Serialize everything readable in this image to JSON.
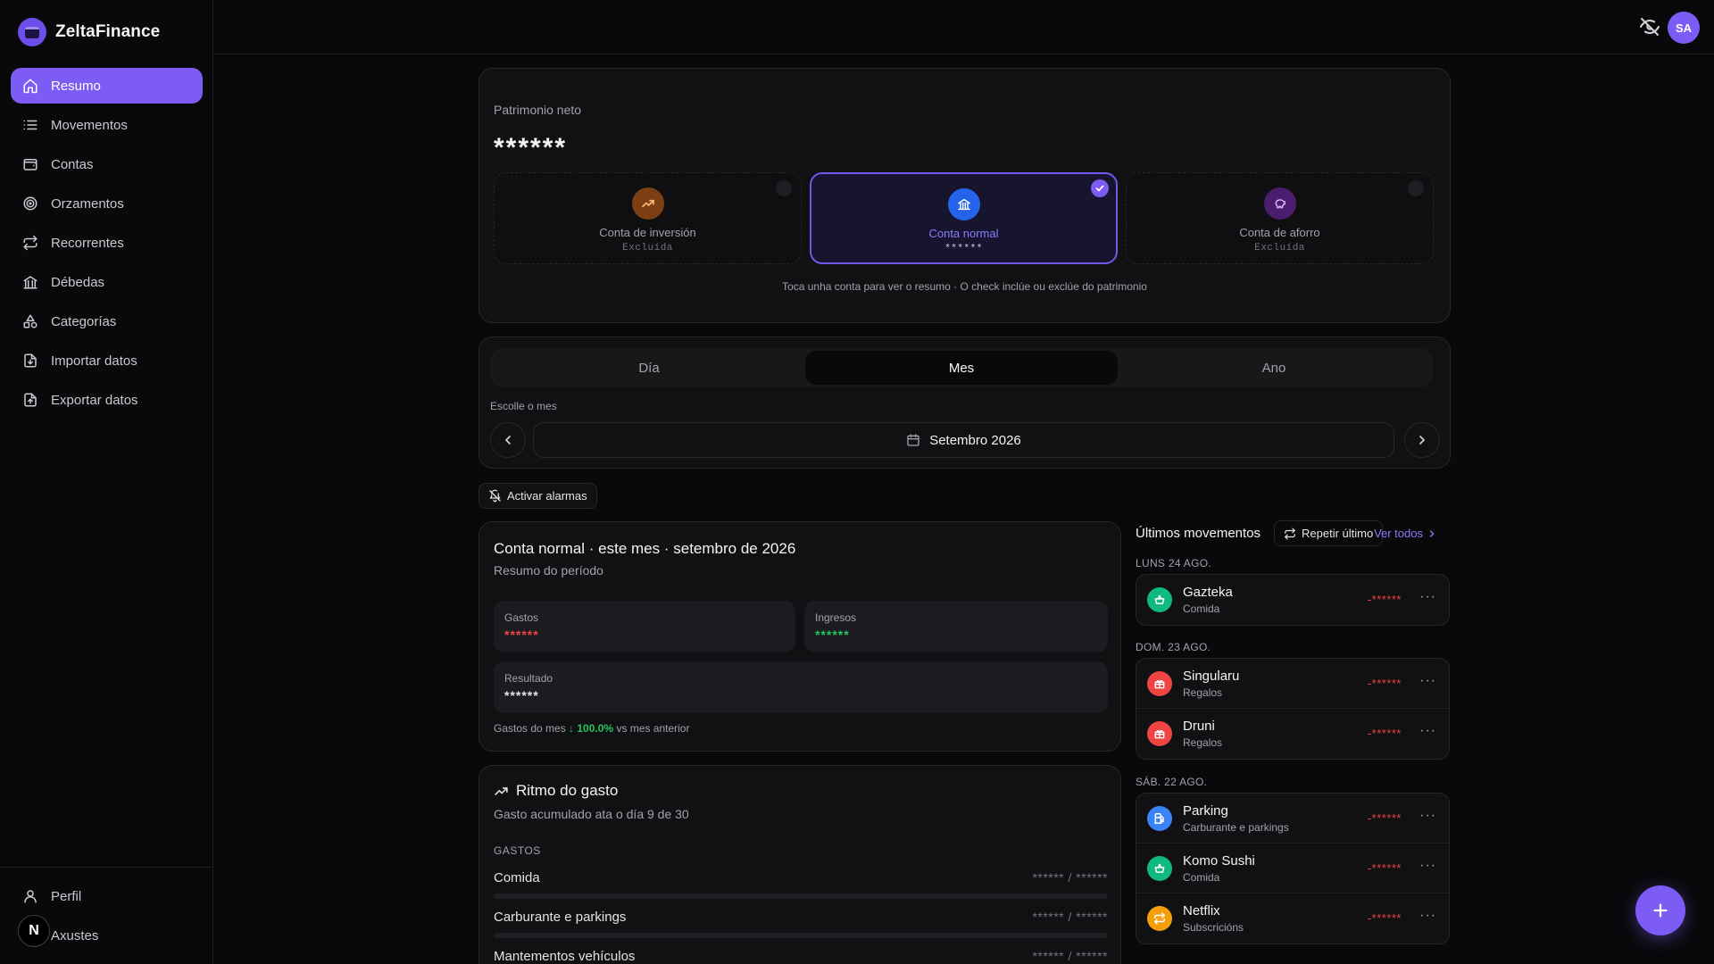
{
  "app": {
    "name": "ZeltaFinance",
    "user_initials": "SA"
  },
  "nav": {
    "items": [
      {
        "label": "Resumo",
        "icon": "home-icon",
        "active": true
      },
      {
        "label": "Movementos",
        "icon": "list-icon"
      },
      {
        "label": "Contas",
        "icon": "wallet-icon"
      },
      {
        "label": "Orzamentos",
        "icon": "target-icon"
      },
      {
        "label": "Recorrentes",
        "icon": "repeat-icon"
      },
      {
        "label": "Débedas",
        "icon": "bank-icon"
      },
      {
        "label": "Categorías",
        "icon": "shapes-icon"
      },
      {
        "label": "Importar datos",
        "icon": "file-import-icon"
      },
      {
        "label": "Exportar datos",
        "icon": "file-export-icon"
      }
    ],
    "bottom": [
      {
        "label": "Perfil",
        "icon": "user-icon"
      },
      {
        "label": "Axustes",
        "icon": "settings-icon"
      }
    ],
    "badge": "N"
  },
  "net_worth": {
    "label": "Patrimonio neto",
    "value": "******",
    "accounts": [
      {
        "name": "Conta de inversión",
        "sub": "Excluída",
        "icon": "trending-up-icon",
        "color": "#b45309",
        "selected": false
      },
      {
        "name": "Conta normal",
        "sub": "******",
        "icon": "bank-icon",
        "color": "#2563eb",
        "selected": true
      },
      {
        "name": "Conta de aforro",
        "sub": "Excluída",
        "icon": "piggy-bank-icon",
        "color": "#7e22ce",
        "selected": false
      }
    ],
    "hint": "Toca unha conta para ver o resumo · O check inclúe ou exclúe do patrimonio"
  },
  "period": {
    "tabs": [
      "Día",
      "Mes",
      "Ano"
    ],
    "active_tab": "Mes",
    "month_label": "Escolle o mes",
    "month_value": "Setembro 2026"
  },
  "alarm_button": "Activar alarmas",
  "summary": {
    "title": "Conta normal · este mes · setembro de 2026",
    "subtitle": "Resumo do período",
    "gastos_label": "Gastos",
    "gastos_value": "******",
    "ingresos_label": "Ingresos",
    "ingresos_value": "******",
    "resultado_label": "Resultado",
    "resultado_value": "******",
    "cmp_prefix": "Gastos do mes",
    "cmp_pct": "↓ 100.0%",
    "cmp_suffix": "vs mes anterior"
  },
  "rhythm": {
    "title": "Ritmo do gasto",
    "subtitle": "Gasto acumulado ata o día 9 de 30",
    "section": "GASTOS",
    "categories": [
      {
        "name": "Comida",
        "value": "****** / ******"
      },
      {
        "name": "Carburante e parkings",
        "value": "****** / ******"
      },
      {
        "name": "Mantementos vehículos",
        "value": "****** / ******"
      }
    ]
  },
  "movements": {
    "title": "Últimos movementos",
    "repeat_label": "Repetir último",
    "see_all": "Ver todos",
    "groups": [
      {
        "day": "LUNS 24 AGO.",
        "items": [
          {
            "name": "Gazteka",
            "category": "Comida",
            "amount": "-******",
            "icon": "basket-icon",
            "color": "#10b981"
          }
        ]
      },
      {
        "day": "DOM. 23 AGO.",
        "items": [
          {
            "name": "Singularu",
            "category": "Regalos",
            "amount": "-******",
            "icon": "gift-icon",
            "color": "#ef4444"
          },
          {
            "name": "Druni",
            "category": "Regalos",
            "amount": "-******",
            "icon": "gift-icon",
            "color": "#ef4444"
          }
        ]
      },
      {
        "day": "SÁB. 22 AGO.",
        "items": [
          {
            "name": "Parking",
            "category": "Carburante e parkings",
            "amount": "-******",
            "icon": "fuel-icon",
            "color": "#3b82f6"
          },
          {
            "name": "Komo Sushi",
            "category": "Comida",
            "amount": "-******",
            "icon": "basket-icon",
            "color": "#10b981"
          },
          {
            "name": "Netflix",
            "category": "Subscricións",
            "amount": "-******",
            "icon": "repeat-icon",
            "color": "#f59e0b"
          }
        ]
      }
    ]
  }
}
